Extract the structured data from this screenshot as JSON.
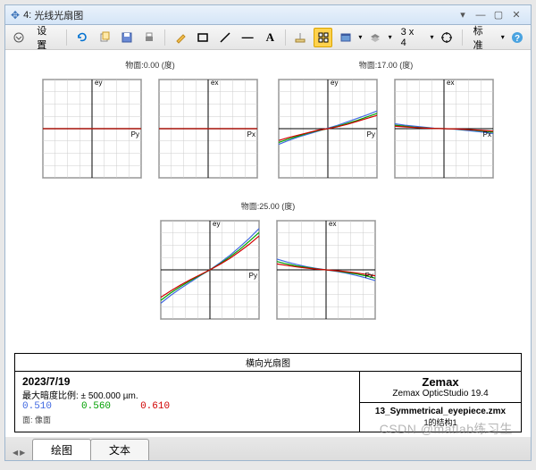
{
  "window": {
    "index": "4:",
    "title": "光线光扇图"
  },
  "toolbar": {
    "settings": "设置",
    "zoom_label": "3 x 4",
    "standard": "标准",
    "text_btn": "A",
    "line_btn": "—"
  },
  "groups": [
    {
      "label": "物面:0.00 (度)"
    },
    {
      "label": "物面:17.00 (度)"
    },
    {
      "label": "物面:25.00 (度)"
    }
  ],
  "axis_py": "Py",
  "axis_px": "Px",
  "axis_ey": "ey",
  "axis_ex": "ex",
  "footer": {
    "panel_title": "横向光扇图",
    "date": "2023/7/19",
    "scale_line": "最大暗度比例: ± 500.000 µm.",
    "wl_blue": "0.510",
    "wl_green": "0.560",
    "wl_red": "0.610",
    "surface": "面: 像面",
    "brand": "Zemax",
    "product": "Zemax OpticStudio 19.4",
    "filename": "13_Symmetrical_eyepiece.zmx",
    "config": "1的结构1"
  },
  "tabs": {
    "plot": "绘图",
    "text": "文本"
  },
  "watermark": "CSDN @matlab练习生",
  "chart_data": [
    {
      "field_deg": 0.0,
      "direction": "Py",
      "type": "line",
      "xlabel": "Py",
      "ylabel": "ey",
      "xlim": [
        -1,
        1
      ],
      "ylim": [
        -500,
        500
      ],
      "series": [
        {
          "name": "0.510",
          "color": "#4169e1",
          "values": [
            0,
            0,
            0,
            0,
            0,
            0,
            0,
            0,
            0,
            0,
            0
          ]
        },
        {
          "name": "0.560",
          "color": "#00a000",
          "values": [
            0,
            0,
            0,
            0,
            0,
            0,
            0,
            0,
            0,
            0,
            0
          ]
        },
        {
          "name": "0.610",
          "color": "#d00000",
          "values": [
            0,
            0,
            0,
            0,
            0,
            0,
            0,
            0,
            0,
            0,
            0
          ]
        }
      ],
      "x": [
        -1,
        -0.8,
        -0.6,
        -0.4,
        -0.2,
        0,
        0.2,
        0.4,
        0.6,
        0.8,
        1
      ]
    },
    {
      "field_deg": 0.0,
      "direction": "Px",
      "type": "line",
      "xlabel": "Px",
      "ylabel": "ex",
      "xlim": [
        -1,
        1
      ],
      "ylim": [
        -500,
        500
      ],
      "series": [
        {
          "name": "0.510",
          "color": "#4169e1",
          "values": [
            0,
            0,
            0,
            0,
            0,
            0,
            0,
            0,
            0,
            0,
            0
          ]
        },
        {
          "name": "0.560",
          "color": "#00a000",
          "values": [
            0,
            0,
            0,
            0,
            0,
            0,
            0,
            0,
            0,
            0,
            0
          ]
        },
        {
          "name": "0.610",
          "color": "#d00000",
          "values": [
            0,
            0,
            0,
            0,
            0,
            0,
            0,
            0,
            0,
            0,
            0
          ]
        }
      ],
      "x": [
        -1,
        -0.8,
        -0.6,
        -0.4,
        -0.2,
        0,
        0.2,
        0.4,
        0.6,
        0.8,
        1
      ]
    },
    {
      "field_deg": 17.0,
      "direction": "Py",
      "type": "line",
      "xlabel": "Py",
      "ylabel": "ey",
      "xlim": [
        -1,
        1
      ],
      "ylim": [
        -500,
        500
      ],
      "series": [
        {
          "name": "0.510",
          "color": "#4169e1",
          "values": [
            -160,
            -120,
            -85,
            -55,
            -25,
            5,
            35,
            70,
            105,
            140,
            180
          ]
        },
        {
          "name": "0.560",
          "color": "#00a000",
          "values": [
            -140,
            -105,
            -75,
            -45,
            -20,
            0,
            25,
            55,
            85,
            120,
            155
          ]
        },
        {
          "name": "0.610",
          "color": "#d00000",
          "values": [
            -120,
            -90,
            -65,
            -40,
            -15,
            0,
            20,
            45,
            75,
            105,
            135
          ]
        }
      ],
      "x": [
        -1,
        -0.8,
        -0.6,
        -0.4,
        -0.2,
        0,
        0.2,
        0.4,
        0.6,
        0.8,
        1
      ]
    },
    {
      "field_deg": 17.0,
      "direction": "Px",
      "type": "line",
      "xlabel": "Px",
      "ylabel": "ex",
      "xlim": [
        -1,
        1
      ],
      "ylim": [
        -500,
        500
      ],
      "series": [
        {
          "name": "0.510",
          "color": "#4169e1",
          "values": [
            50,
            35,
            25,
            15,
            5,
            0,
            -5,
            -15,
            -25,
            -35,
            -50
          ]
        },
        {
          "name": "0.560",
          "color": "#00a000",
          "values": [
            35,
            25,
            15,
            8,
            3,
            0,
            -3,
            -8,
            -15,
            -25,
            -35
          ]
        },
        {
          "name": "0.610",
          "color": "#d00000",
          "values": [
            25,
            18,
            12,
            6,
            2,
            0,
            -2,
            -6,
            -12,
            -18,
            -25
          ]
        }
      ],
      "x": [
        -1,
        -0.8,
        -0.6,
        -0.4,
        -0.2,
        0,
        0.2,
        0.4,
        0.6,
        0.8,
        1
      ]
    },
    {
      "field_deg": 25.0,
      "direction": "Py",
      "type": "line",
      "xlabel": "Py",
      "ylabel": "ey",
      "xlim": [
        -1,
        1
      ],
      "ylim": [
        -500,
        500
      ],
      "series": [
        {
          "name": "0.510",
          "color": "#4169e1",
          "values": [
            -340,
            -260,
            -190,
            -125,
            -60,
            0,
            70,
            145,
            230,
            320,
            420
          ]
        },
        {
          "name": "0.560",
          "color": "#00a000",
          "values": [
            -310,
            -235,
            -170,
            -110,
            -55,
            0,
            60,
            130,
            205,
            290,
            380
          ]
        },
        {
          "name": "0.610",
          "color": "#d00000",
          "values": [
            -280,
            -215,
            -155,
            -100,
            -50,
            0,
            55,
            115,
            185,
            260,
            345
          ]
        }
      ],
      "x": [
        -1,
        -0.8,
        -0.6,
        -0.4,
        -0.2,
        0,
        0.2,
        0.4,
        0.6,
        0.8,
        1
      ]
    },
    {
      "field_deg": 25.0,
      "direction": "Px",
      "type": "line",
      "xlabel": "Px",
      "ylabel": "ex",
      "xlim": [
        -1,
        1
      ],
      "ylim": [
        -500,
        500
      ],
      "series": [
        {
          "name": "0.510",
          "color": "#4169e1",
          "values": [
            110,
            80,
            55,
            32,
            15,
            0,
            -15,
            -32,
            -55,
            -80,
            -110
          ]
        },
        {
          "name": "0.560",
          "color": "#00a000",
          "values": [
            85,
            60,
            40,
            25,
            10,
            0,
            -10,
            -25,
            -40,
            -60,
            -85
          ]
        },
        {
          "name": "0.610",
          "color": "#d00000",
          "values": [
            60,
            45,
            30,
            18,
            8,
            0,
            -8,
            -18,
            -30,
            -45,
            -60
          ]
        }
      ],
      "x": [
        -1,
        -0.8,
        -0.6,
        -0.4,
        -0.2,
        0,
        0.2,
        0.4,
        0.6,
        0.8,
        1
      ]
    }
  ]
}
